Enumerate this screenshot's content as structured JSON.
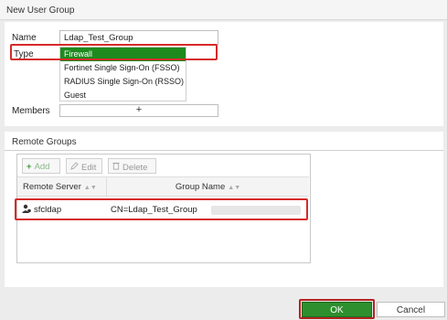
{
  "dialog": {
    "title": "New User Group"
  },
  "form": {
    "name_label": "Name",
    "name_value": "Ldap_Test_Group",
    "type_label": "Type",
    "type_options": [
      "Firewall",
      "Fortinet Single Sign-On (FSSO)",
      "RADIUS Single Sign-On (RSSO)",
      "Guest"
    ],
    "type_selected": "Firewall",
    "members_label": "Members",
    "members_add": "+"
  },
  "remote_groups": {
    "section_title": "Remote Groups",
    "toolbar": {
      "add": "Add",
      "edit": "Edit",
      "delete": "Delete"
    },
    "columns": [
      "Remote Server",
      "Group Name"
    ],
    "rows": [
      {
        "server": "sfcldap",
        "group": "CN=Ldap_Test_Group"
      }
    ]
  },
  "footer": {
    "ok": "OK",
    "cancel": "Cancel"
  },
  "colors": {
    "accent_green": "#1e8a1e",
    "highlight_red": "#d62a2a"
  }
}
